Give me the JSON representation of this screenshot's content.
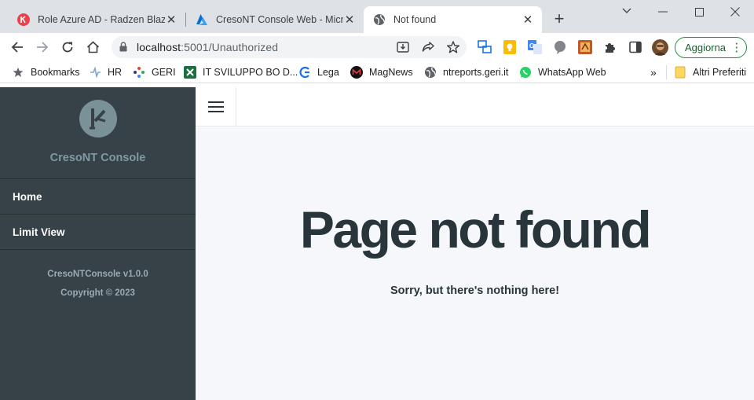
{
  "browser": {
    "tabs": [
      {
        "title": "Role Azure AD - Radzen Blazor",
        "active": false
      },
      {
        "title": "CresoNT Console Web - Microsoft Azure",
        "active": false
      },
      {
        "title": "Not found",
        "active": true
      }
    ],
    "new_tab_label": "+",
    "address": {
      "host": "localhost",
      "path": ":5001/Unauthorized"
    },
    "update_label": "Aggiorna",
    "bookmarks": [
      {
        "label": "Bookmarks",
        "icon": "star-icon"
      },
      {
        "label": "HR",
        "icon": "hr-icon"
      },
      {
        "label": "GERI",
        "icon": "geri-icon"
      },
      {
        "label": "IT SVILUPPO BO D...",
        "icon": "excel-icon"
      },
      {
        "label": "Lega",
        "icon": "lega-icon"
      },
      {
        "label": "MagNews",
        "icon": "magnews-icon"
      },
      {
        "label": "ntreports.geri.it",
        "icon": "globe-icon"
      },
      {
        "label": "WhatsApp Web",
        "icon": "whatsapp-icon"
      }
    ],
    "bookmarks_overflow": "»",
    "other_bookmarks": "Altri Preferiti"
  },
  "app": {
    "name": "CresoNT Console",
    "nav": [
      {
        "label": "Home"
      },
      {
        "label": "Limit View"
      }
    ],
    "version": "CresoNTConsole v1.0.0",
    "copyright": "Copyright © 2023"
  },
  "page": {
    "title": "Page not found",
    "message": "Sorry, but there's nothing here!"
  },
  "colors": {
    "sidebar_bg": "#364247",
    "content_bg": "#f6f7fa",
    "title_text": "#28353a",
    "update_accent": "#1e8e3e"
  }
}
